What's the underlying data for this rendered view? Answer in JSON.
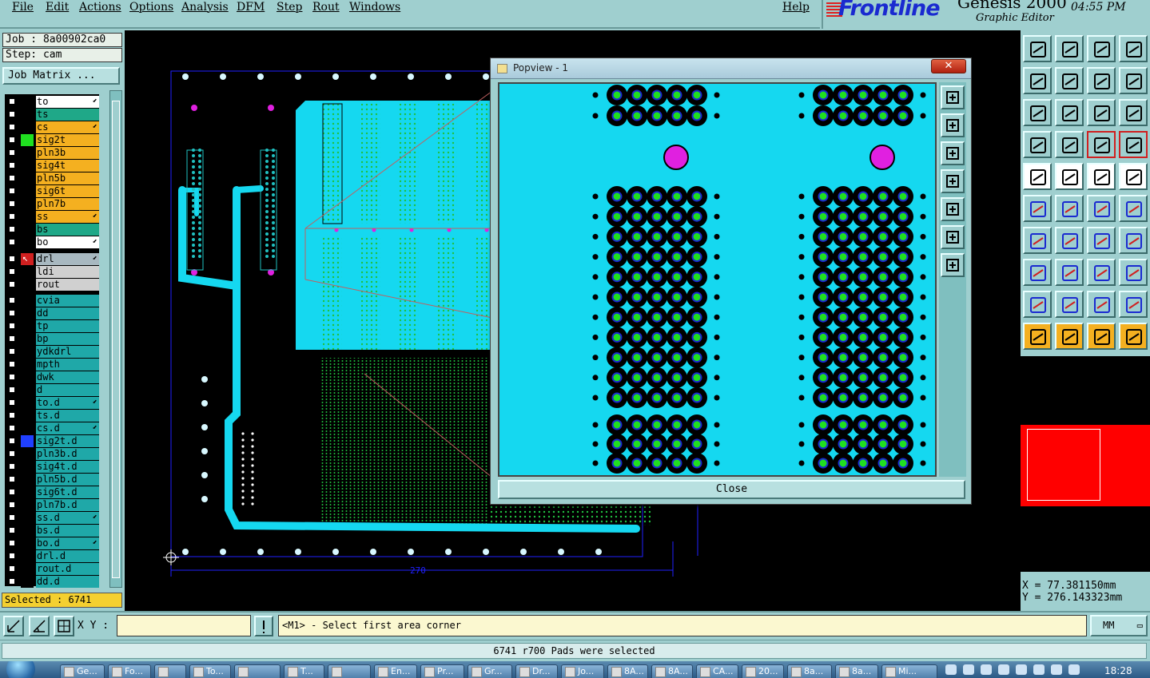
{
  "menu": [
    "File",
    "Edit",
    "Actions",
    "Options",
    "Analysis",
    "DFM",
    "Step",
    "Rout",
    "Windows"
  ],
  "help": "Help",
  "brand": {
    "logo": "Frontline",
    "product": "Genesis 2000",
    "subtitle": "Graphic Editor",
    "time": "04:55 PM"
  },
  "job": {
    "job_label": "Job : 8a00902ca0",
    "step_label": "Step: cam",
    "matrix_button": "Job Matrix ..."
  },
  "layers_board": [
    {
      "name": "to",
      "color": "#ffffff",
      "swatch": "#000000",
      "edit": true
    },
    {
      "name": "ts",
      "color": "#1fa888",
      "swatch": "#000000",
      "edit": false
    },
    {
      "name": "cs",
      "color": "#f4b020",
      "swatch": "#000000",
      "edit": true
    },
    {
      "name": "sig2t",
      "color": "#f4b020",
      "swatch": "#20e020",
      "edit": false
    },
    {
      "name": "pln3b",
      "color": "#f4b020",
      "swatch": "#000000",
      "edit": false
    },
    {
      "name": "sig4t",
      "color": "#f4b020",
      "swatch": "#000000",
      "edit": false
    },
    {
      "name": "pln5b",
      "color": "#f4b020",
      "swatch": "#000000",
      "edit": false
    },
    {
      "name": "sig6t",
      "color": "#f4b020",
      "swatch": "#000000",
      "edit": false
    },
    {
      "name": "pln7b",
      "color": "#f4b020",
      "swatch": "#000000",
      "edit": false
    },
    {
      "name": "ss",
      "color": "#f4b020",
      "swatch": "#000000",
      "edit": true
    },
    {
      "name": "bs",
      "color": "#1fa888",
      "swatch": "#000000",
      "edit": false
    },
    {
      "name": "bo",
      "color": "#ffffff",
      "swatch": "#000000",
      "edit": true
    }
  ],
  "layers_drill": [
    {
      "name": "drl",
      "color": "#a8b8c0",
      "swatch": "#000000",
      "edit": true
    },
    {
      "name": "ldi",
      "color": "#d0d0d0",
      "swatch": "#000000",
      "edit": false
    },
    {
      "name": "rout",
      "color": "#d0d0d0",
      "swatch": "#000000",
      "edit": false
    }
  ],
  "layers_misc": [
    {
      "name": "cvia",
      "color": "#1fa8a8",
      "swatch": "#000000",
      "edit": false
    },
    {
      "name": "dd",
      "color": "#1fa8a8",
      "swatch": "#000000",
      "edit": false
    },
    {
      "name": "tp",
      "color": "#1fa8a8",
      "swatch": "#000000",
      "edit": false
    },
    {
      "name": "bp",
      "color": "#1fa8a8",
      "swatch": "#000000",
      "edit": false
    },
    {
      "name": "ydkdrl",
      "color": "#1fa8a8",
      "swatch": "#000000",
      "edit": false
    },
    {
      "name": "mpth",
      "color": "#1fa8a8",
      "swatch": "#000000",
      "edit": false
    },
    {
      "name": "dwk",
      "color": "#1fa8a8",
      "swatch": "#000000",
      "edit": false
    },
    {
      "name": "d",
      "color": "#1fa8a8",
      "swatch": "#000000",
      "edit": false
    },
    {
      "name": "to.d",
      "color": "#1fa8a8",
      "swatch": "#000000",
      "edit": true
    },
    {
      "name": "ts.d",
      "color": "#1fa8a8",
      "swatch": "#000000",
      "edit": false
    },
    {
      "name": "cs.d",
      "color": "#1fa8a8",
      "swatch": "#000000",
      "edit": true
    },
    {
      "name": "sig2t.d",
      "color": "#1fa8a8",
      "swatch": "#2040ff",
      "edit": false
    },
    {
      "name": "pln3b.d",
      "color": "#1fa8a8",
      "swatch": "#000000",
      "edit": false
    },
    {
      "name": "sig4t.d",
      "color": "#1fa8a8",
      "swatch": "#000000",
      "edit": false
    },
    {
      "name": "pln5b.d",
      "color": "#1fa8a8",
      "swatch": "#000000",
      "edit": false
    },
    {
      "name": "sig6t.d",
      "color": "#1fa8a8",
      "swatch": "#000000",
      "edit": false
    },
    {
      "name": "pln7b.d",
      "color": "#1fa8a8",
      "swatch": "#000000",
      "edit": false
    },
    {
      "name": "ss.d",
      "color": "#1fa8a8",
      "swatch": "#000000",
      "edit": true
    },
    {
      "name": "bs.d",
      "color": "#1fa8a8",
      "swatch": "#000000",
      "edit": false
    },
    {
      "name": "bo.d",
      "color": "#1fa8a8",
      "swatch": "#000000",
      "edit": true
    },
    {
      "name": "drl.d",
      "color": "#1fa8a8",
      "swatch": "#000000",
      "edit": false
    },
    {
      "name": "rout.d",
      "color": "#1fa8a8",
      "swatch": "#000000",
      "edit": false
    },
    {
      "name": "dd.d",
      "color": "#1fa8a8",
      "swatch": "#000000",
      "edit": false
    }
  ],
  "selected_label": "Selected : 6741",
  "dimension_label": "270",
  "popup": {
    "title": "Popview - 1",
    "close_x": "✕",
    "close_button": "Close"
  },
  "coords": {
    "x": "X =  77.381150mm",
    "y": "Y = 276.143323mm"
  },
  "cmd": {
    "xy_label": "X Y :",
    "xy_value": "",
    "prompt": "<M1> - Select first area corner",
    "units": "MM"
  },
  "status": "6741 r700 Pads were selected",
  "taskbar": [
    "Ge...",
    "Fo...",
    "",
    "To...",
    "",
    "T...",
    "",
    "En...",
    "Pr...",
    "Gr...",
    "Dr...",
    "Jo...",
    "8A...",
    "8A...",
    "CA...",
    "20...",
    "8a...",
    "8a...",
    "Mi..."
  ],
  "taskbar_clock": "18:28",
  "colors": {
    "panel": "#9fcfcf",
    "cyan_copper": "#15d8f0",
    "pad_green": "#20e020",
    "magenta": "#e020e0",
    "highlight": "#f4b020"
  }
}
